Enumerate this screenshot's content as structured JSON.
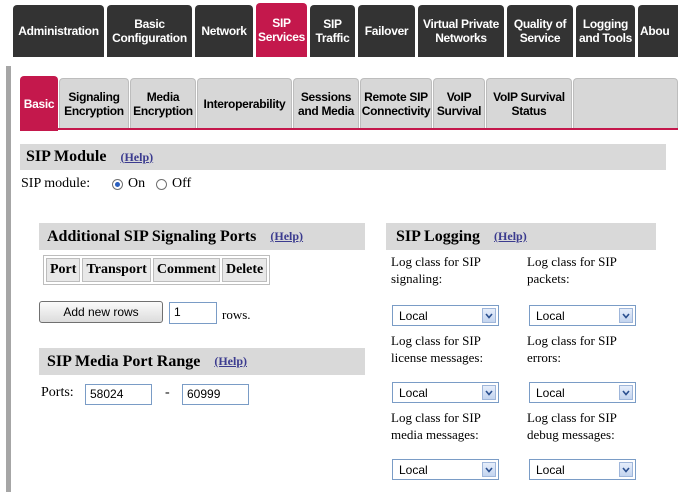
{
  "top_nav": [
    {
      "label": "Administration",
      "active": false
    },
    {
      "label": "Basic\nConfiguration",
      "active": false
    },
    {
      "label": "Network",
      "active": false
    },
    {
      "label": "SIP\nServices",
      "active": true
    },
    {
      "label": "SIP\nTraffic",
      "active": false
    },
    {
      "label": "Failover",
      "active": false
    },
    {
      "label": "Virtual Private\nNetworks",
      "active": false
    },
    {
      "label": "Quality of\nService",
      "active": false
    },
    {
      "label": "Logging\nand Tools",
      "active": false
    },
    {
      "label": "Abou",
      "active": false
    }
  ],
  "sub_nav": [
    {
      "label": "Basic",
      "active": true
    },
    {
      "label": "Signaling\nEncryption",
      "active": false
    },
    {
      "label": "Media\nEncryption",
      "active": false
    },
    {
      "label": "Interoperability",
      "active": false
    },
    {
      "label": "Sessions\nand Media",
      "active": false
    },
    {
      "label": "Remote SIP\nConnectivity",
      "active": false
    },
    {
      "label": "VoIP\nSurvival",
      "active": false
    },
    {
      "label": "VoIP Survival\nStatus",
      "active": false
    }
  ],
  "sip_module": {
    "title": "SIP Module",
    "help": "(Help)",
    "label": "SIP module:",
    "options": [
      {
        "label": "On",
        "checked": true
      },
      {
        "label": "Off",
        "checked": false
      }
    ]
  },
  "signaling_ports": {
    "title": "Additional SIP Signaling Ports",
    "help": "(Help)",
    "columns": [
      "Port",
      "Transport",
      "Comment",
      "Delete"
    ],
    "add_button": "Add new rows",
    "rows_value": "1",
    "rows_suffix": "rows."
  },
  "media_port_range": {
    "title": "SIP Media Port Range",
    "help": "(Help)",
    "label": "Ports:",
    "start": "58024",
    "separator": "-",
    "end": "60999"
  },
  "sip_logging": {
    "title": "SIP Logging",
    "help": "(Help)",
    "fields": [
      {
        "label": "Log class for SIP\nsignaling:",
        "value": "Local"
      },
      {
        "label": "Log class for SIP\npackets:",
        "value": "Local"
      },
      {
        "label": "Log class for SIP\nlicense messages:",
        "value": "Local"
      },
      {
        "label": "Log class for SIP\nerrors:",
        "value": "Local"
      },
      {
        "label": "Log class for SIP\nmedia messages:",
        "value": "Local"
      },
      {
        "label": "Log class for SIP\ndebug messages:",
        "value": "Local"
      }
    ]
  },
  "colors": {
    "nav_dark": "#333333",
    "accent": "#c4184c",
    "section_gray": "#d9d9d9",
    "help_link": "#3b3b8f"
  }
}
